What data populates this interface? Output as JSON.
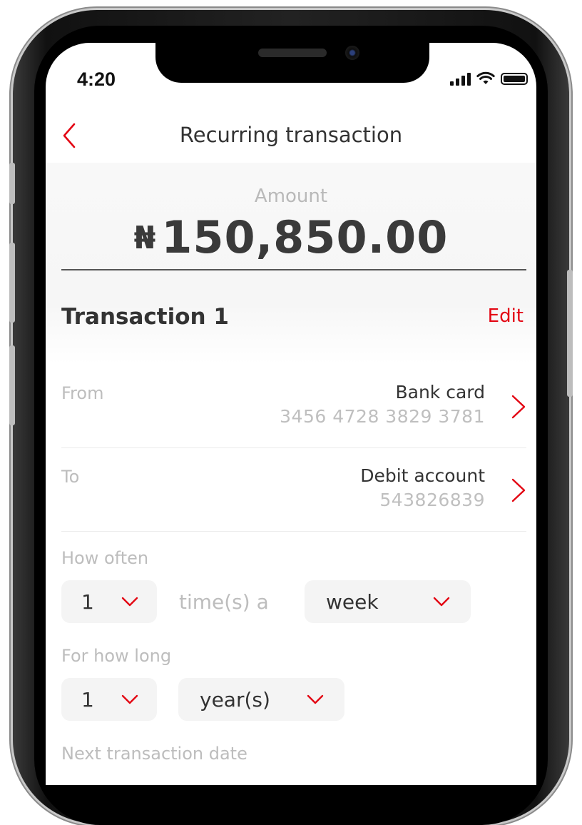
{
  "status_bar": {
    "time": "4:20"
  },
  "header": {
    "title": "Recurring transaction"
  },
  "amount": {
    "label": "Amount",
    "currency": "₦",
    "value": "150,850.00"
  },
  "transaction": {
    "title": "Transaction 1",
    "edit_label": "Edit"
  },
  "from": {
    "label": "From",
    "name": "Bank card",
    "number": "3456 4728 3829 3781"
  },
  "to": {
    "label": "To",
    "name": "Debit account",
    "number": "543826839"
  },
  "how_often": {
    "label": "How often",
    "count": "1",
    "between": "time(s) a",
    "period": "week"
  },
  "for_how_long": {
    "label": "For how long",
    "count": "1",
    "unit": "year(s)"
  },
  "next_date": {
    "label": "Next transaction date"
  },
  "colors": {
    "accent": "#e30613",
    "text": "#333333",
    "muted": "#bdbdbd"
  }
}
